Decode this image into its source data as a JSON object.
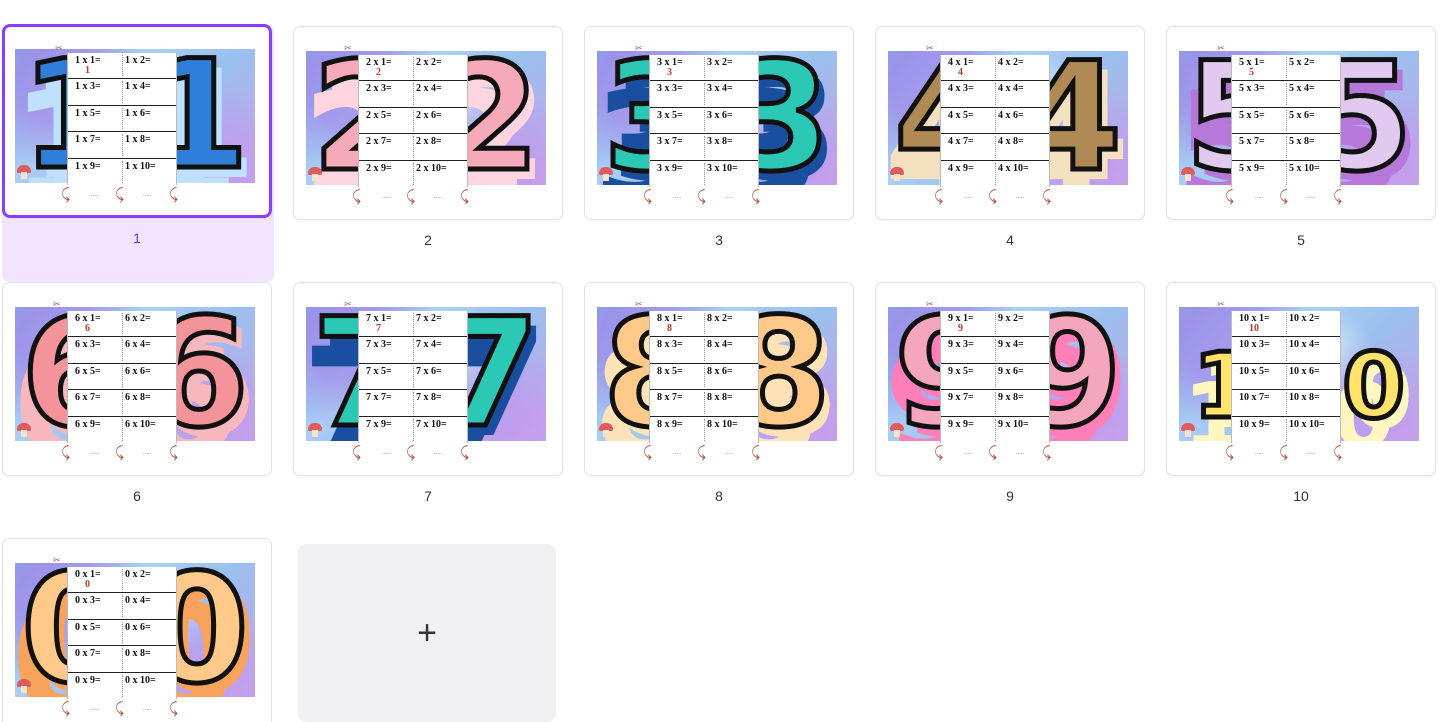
{
  "pages": [
    {
      "num": "1",
      "digits": [
        "1"
      ],
      "fill": "#2f7fd8",
      "star": "#bfe0ff",
      "rows": [
        [
          "1 x 1=",
          "1 x 2="
        ],
        [
          "1 x 3=",
          "1 x 4="
        ],
        [
          "1 x 5=",
          "1 x 6="
        ],
        [
          "1 x 7=",
          "1 x 8="
        ],
        [
          "1 x 9=",
          "1 x 10="
        ]
      ],
      "answer": "1",
      "selected": true
    },
    {
      "num": "2",
      "digits": [
        "2"
      ],
      "fill": "#f6a9b8",
      "star": "#ffd6e0",
      "rows": [
        [
          "2 x 1=",
          "2 x 2="
        ],
        [
          "2 x 3=",
          "2 x 4="
        ],
        [
          "2 x 5=",
          "2 x 6="
        ],
        [
          "2 x 7=",
          "2 x 8="
        ],
        [
          "2 x 9=",
          "2 x 10="
        ]
      ],
      "answer": "2"
    },
    {
      "num": "3",
      "digits": [
        "3"
      ],
      "fill": "#2cc8b6",
      "star": "#1a4fa0",
      "rows": [
        [
          "3 x 1=",
          "3 x 2="
        ],
        [
          "3 x 3=",
          "3 x 4="
        ],
        [
          "3 x 5=",
          "3 x 6="
        ],
        [
          "3 x 7=",
          "3 x 8="
        ],
        [
          "3 x 9=",
          "3 x 10="
        ]
      ],
      "answer": "3"
    },
    {
      "num": "4",
      "digits": [
        "4"
      ],
      "fill": "#b08a55",
      "star": "#f3e1c0",
      "rows": [
        [
          "4 x 1=",
          "4 x 2="
        ],
        [
          "4 x 3=",
          "4 x 4="
        ],
        [
          "4 x 5=",
          "4 x 6="
        ],
        [
          "4 x 7=",
          "4 x 8="
        ],
        [
          "4 x 9=",
          "4 x 10="
        ]
      ],
      "answer": "4"
    },
    {
      "num": "5",
      "digits": [
        "5"
      ],
      "fill": "#e2c9f0",
      "star": "#b779d9",
      "rows": [
        [
          "5 x 1=",
          "5 x 2="
        ],
        [
          "5 x 3=",
          "5 x 4="
        ],
        [
          "5 x 5=",
          "5 x 6="
        ],
        [
          "5 x 7=",
          "5 x 8="
        ],
        [
          "5 x 9=",
          "5 x 10="
        ]
      ],
      "answer": "5"
    },
    {
      "num": "6",
      "digits": [
        "6"
      ],
      "fill": "#f4939a",
      "star": "#f7b8bd",
      "rows": [
        [
          "6 x 1=",
          "6 x 2="
        ],
        [
          "6 x 3=",
          "6 x 4="
        ],
        [
          "6 x 5=",
          "6 x 6="
        ],
        [
          "6 x 7=",
          "6 x 8="
        ],
        [
          "6 x 9=",
          "6 x 10="
        ]
      ],
      "answer": "6"
    },
    {
      "num": "7",
      "digits": [
        "7"
      ],
      "fill": "#2cc8b6",
      "star": "#1a4fa0",
      "rows": [
        [
          "7 x 1=",
          "7 x 2="
        ],
        [
          "7 x 3=",
          "7 x 4="
        ],
        [
          "7 x 5=",
          "7 x 6="
        ],
        [
          "7 x 7=",
          "7 x 8="
        ],
        [
          "7 x 9=",
          "7 x 10="
        ]
      ],
      "answer": "7"
    },
    {
      "num": "8",
      "digits": [
        "8"
      ],
      "fill": "#ffc98a",
      "star": "#ffe3b8",
      "rows": [
        [
          "8 x 1=",
          "8 x 2="
        ],
        [
          "8 x 3=",
          "8 x 4="
        ],
        [
          "8 x 5=",
          "8 x 6="
        ],
        [
          "8 x 7=",
          "8 x 8="
        ],
        [
          "8 x 9=",
          "8 x 10="
        ]
      ],
      "answer": "8"
    },
    {
      "num": "9",
      "digits": [
        "9"
      ],
      "fill": "#f4a6bd",
      "star": "#ff7fb8",
      "rows": [
        [
          "9 x 1=",
          "9 x 2="
        ],
        [
          "9 x 3=",
          "9 x 4="
        ],
        [
          "9 x 5=",
          "9 x 6="
        ],
        [
          "9 x 7=",
          "9 x 8="
        ],
        [
          "9 x 9=",
          "9 x 10="
        ]
      ],
      "answer": "9"
    },
    {
      "num": "10",
      "digits": [
        "1",
        "0"
      ],
      "fill": "#ffe36a",
      "star": "#fff6c0",
      "rows": [
        [
          "10 x 1=",
          "10 x 2="
        ],
        [
          "10 x 3=",
          "10 x 4="
        ],
        [
          "10 x 5=",
          "10 x 6="
        ],
        [
          "10 x 7=",
          "10 x 8="
        ],
        [
          "10 x 9=",
          "10 x 10="
        ]
      ],
      "answer": "10"
    },
    {
      "num": "",
      "digits": [
        "0"
      ],
      "fill": "#ffc98a",
      "star": "#f7a35c",
      "rows": [
        [
          "0 x 1=",
          "0 x 2="
        ],
        [
          "0 x 3=",
          "0 x 4="
        ],
        [
          "0 x 5=",
          "0 x 6="
        ],
        [
          "0 x 7=",
          "0 x 8="
        ],
        [
          "0 x 9=",
          "0 x 10="
        ]
      ],
      "answer": "0"
    }
  ],
  "add_page": {
    "label": "+",
    "icon": "plus-icon"
  }
}
